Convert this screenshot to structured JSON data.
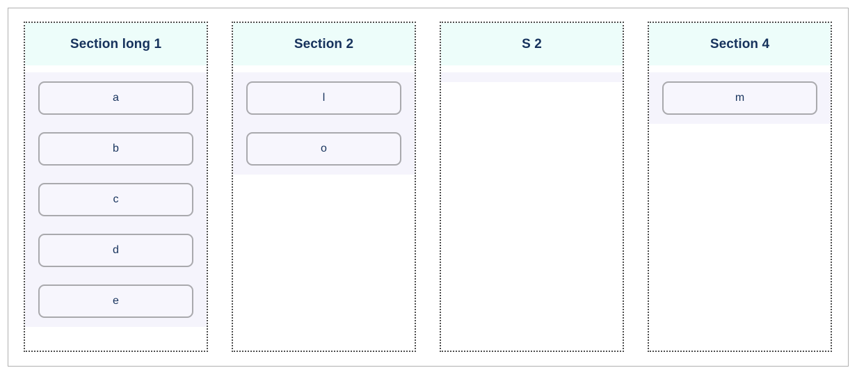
{
  "board": {
    "columns": [
      {
        "title": "Section long 1",
        "cards": [
          {
            "label": "a"
          },
          {
            "label": "b"
          },
          {
            "label": "c"
          },
          {
            "label": "d"
          },
          {
            "label": "e"
          }
        ]
      },
      {
        "title": "Section 2",
        "cards": [
          {
            "label": "l"
          },
          {
            "label": "o"
          }
        ]
      },
      {
        "title": "S 2",
        "cards": []
      },
      {
        "title": "Section 4",
        "cards": [
          {
            "label": "m"
          }
        ]
      }
    ]
  },
  "colors": {
    "header_background": "#edfdfa",
    "header_text": "#16325c",
    "dropzone_background": "#f5f4fc",
    "card_background": "#f7f6fd",
    "card_border": "#a9a9ad",
    "card_text": "#16325c",
    "column_border": "#4d4d4d",
    "frame_border": "#b0b0b0",
    "page_background": "#ffffff"
  }
}
